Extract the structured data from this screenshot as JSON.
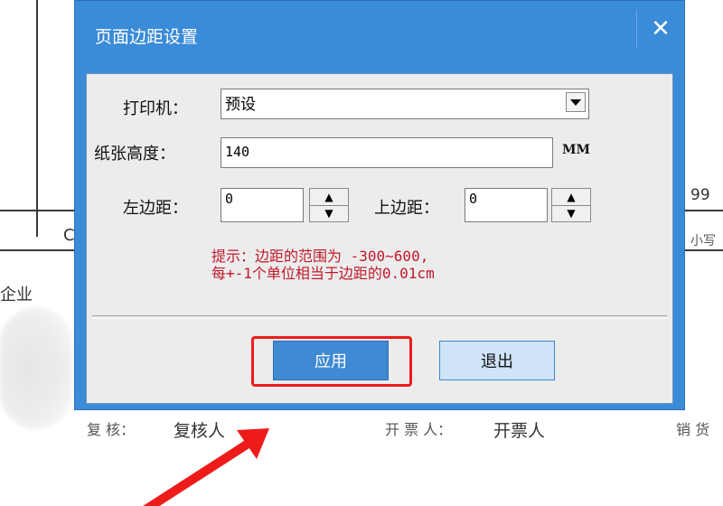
{
  "background": {
    "text_left_mid": "企业",
    "partial_c": "C",
    "partial_right_top": "99",
    "partial_right_mid": "小写",
    "review_label": "复 核：",
    "review_value": "复核人",
    "drawer_label": "开 票 人：",
    "drawer_value": "开票人",
    "seller_label": "销 货"
  },
  "dialog": {
    "title": "页面边距设置",
    "close_glyph": "✕",
    "printer_label": "打印机：",
    "printer_value": "预设",
    "paper_height_label": "纸张高度：",
    "paper_height_value": "140",
    "paper_height_unit": "MM",
    "left_margin_label": "左边距：",
    "left_margin_value": "0",
    "top_margin_label": "上边距：",
    "top_margin_value": "0",
    "hint_line1": "提示：边距的范围为 -300~600,",
    "hint_line2": "每+-1个单位相当于边距的0.01cm",
    "apply_label": "应用",
    "exit_label": "退出"
  },
  "colors": {
    "title_bar": "#3a8bd8",
    "hint": "#c0182a",
    "highlight": "#ee1b1b",
    "arrow": "#ee1b1b"
  }
}
